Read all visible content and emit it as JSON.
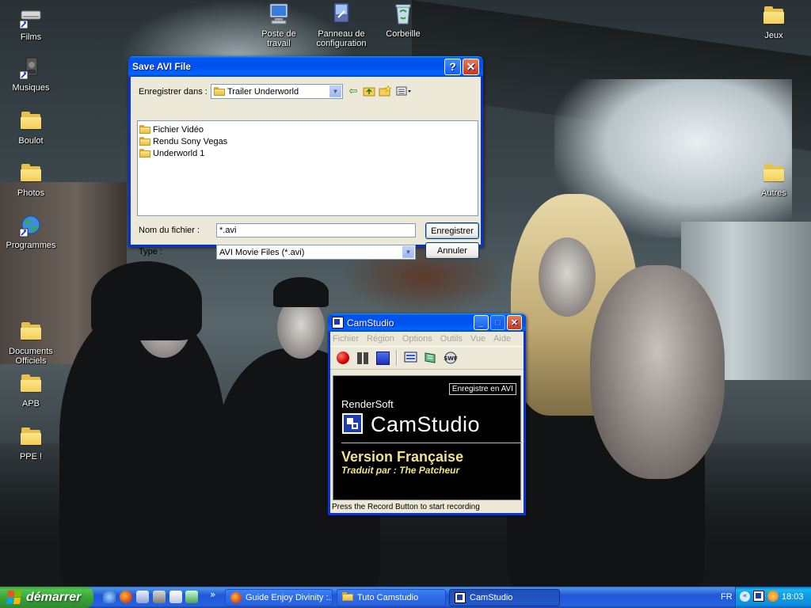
{
  "desktop": {
    "icons_left": [
      {
        "label": "Films",
        "icon": "films-shortcut-icon"
      },
      {
        "label": "Musiques",
        "icon": "musiques-shortcut-icon"
      },
      {
        "label": "Boulot",
        "icon": "folder-icon"
      },
      {
        "label": "Photos",
        "icon": "folder-icon"
      },
      {
        "label": "Programmes",
        "icon": "globe-icon"
      },
      {
        "label": "Documents Officiels",
        "icon": "folder-icon"
      },
      {
        "label": "APB",
        "icon": "folder-icon"
      },
      {
        "label": "PPE !",
        "icon": "folder-icon"
      }
    ],
    "icons_top": [
      {
        "label": "Poste de travail",
        "icon": "computer-icon"
      },
      {
        "label": "Panneau de configuration",
        "icon": "control-panel-icon"
      },
      {
        "label": "Corbeille",
        "icon": "recycle-bin-icon"
      }
    ],
    "icons_right": [
      {
        "label": "Jeux",
        "icon": "folder-icon"
      },
      {
        "label": "Autres",
        "icon": "folder-icon"
      }
    ]
  },
  "save_dialog": {
    "title": "Save AVI File",
    "help_label": "?",
    "close_label": "✕",
    "save_in_label": "Enregistrer dans :",
    "save_in_value": "Trailer Underworld",
    "files": [
      {
        "name": "Fichier Vidéo"
      },
      {
        "name": "Rendu Sony Vegas"
      },
      {
        "name": "Underworld 1"
      }
    ],
    "filename_label": "Nom du fichier :",
    "filename_value": "*.avi",
    "type_label": "Type :",
    "type_value": "AVI Movie Files (*.avi)",
    "save_button": "Enregistrer",
    "cancel_button": "Annuler"
  },
  "camstudio": {
    "title": "CamStudio",
    "minimize_label": "_",
    "maximize_label": "□",
    "close_label": "✕",
    "menu": [
      "Fichier",
      "Région",
      "Options",
      "Outils",
      "Vue",
      "Aide"
    ],
    "splash": {
      "badge": "Enregistre en AVI",
      "company": "RenderSoft",
      "product": "CamStudio",
      "version": "Version Française",
      "credit": "Traduit par : The Patcheur"
    },
    "status": "Press the Record Button to start recording"
  },
  "taskbar": {
    "start_label": "démarrer",
    "overflow_label": "»",
    "tasks": [
      {
        "label": "Guide Enjoy Divinity :...",
        "active": false
      },
      {
        "label": "Tuto Camstudio",
        "active": false
      },
      {
        "label": "CamStudio",
        "active": true
      }
    ],
    "language": "FR",
    "clock": "18:03"
  },
  "colors": {
    "xp_blue": "#0053ee",
    "taskbar_blue": "#245edb",
    "start_green": "#3c9a3c",
    "tray_blue": "#139ee9",
    "cam_gold": "#f0e38c"
  }
}
